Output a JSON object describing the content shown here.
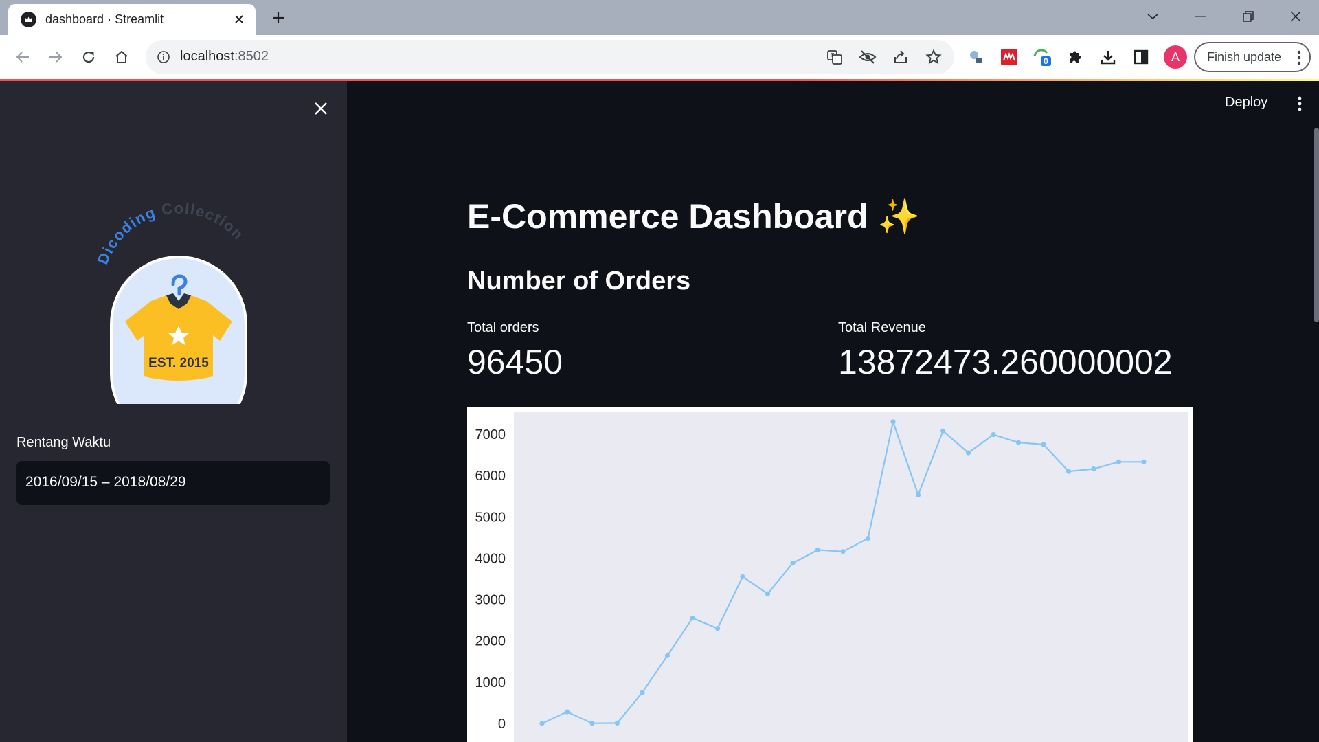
{
  "browser": {
    "tab_title": "dashboard · Streamlit",
    "url_host": "localhost",
    "url_port": ":8502",
    "extension_badge": "0",
    "profile_initial": "A",
    "update_button_label": "Finish update"
  },
  "sidebar": {
    "logo_brand_text_1": "Dicoding",
    "logo_brand_text_2": "Collection",
    "logo_est_text": "EST. 2015",
    "date_range_label": "Rentang Waktu",
    "date_range_value": "2016/09/15 – 2018/08/29"
  },
  "header": {
    "deploy_label": "Deploy"
  },
  "main": {
    "title": "E-Commerce Dashboard ✨",
    "section_title": "Number of Orders",
    "metrics": [
      {
        "label": "Total orders",
        "value": "96450"
      },
      {
        "label": "Total Revenue",
        "value": "13872473.260000002"
      }
    ]
  },
  "colors": {
    "line": "#86c6f4",
    "plot_bg": "#eaeaf2",
    "accent": "#ff4b4b"
  },
  "chart_data": {
    "type": "line",
    "x": [
      1,
      2,
      3,
      4,
      5,
      6,
      7,
      8,
      9,
      10,
      11,
      12,
      13,
      14,
      15,
      16,
      16.99,
      18,
      19,
      20,
      21,
      22,
      23,
      24,
      25
    ],
    "series": [
      {
        "values": [
          0,
          280,
          5,
          10,
          750,
          1640,
          2550,
          2300,
          3550,
          3140,
          3880,
          4200,
          4160,
          4480,
          7300,
          5530,
          7080,
          6550,
          6990,
          6800,
          6750,
          6100,
          6160,
          6330,
          6330
        ]
      }
    ],
    "yticks": [
      0,
      1000,
      2000,
      3000,
      4000,
      5000,
      6000,
      7000
    ],
    "ylim": [
      0,
      7500
    ],
    "xlabel": "",
    "ylabel": "",
    "grid": false
  }
}
